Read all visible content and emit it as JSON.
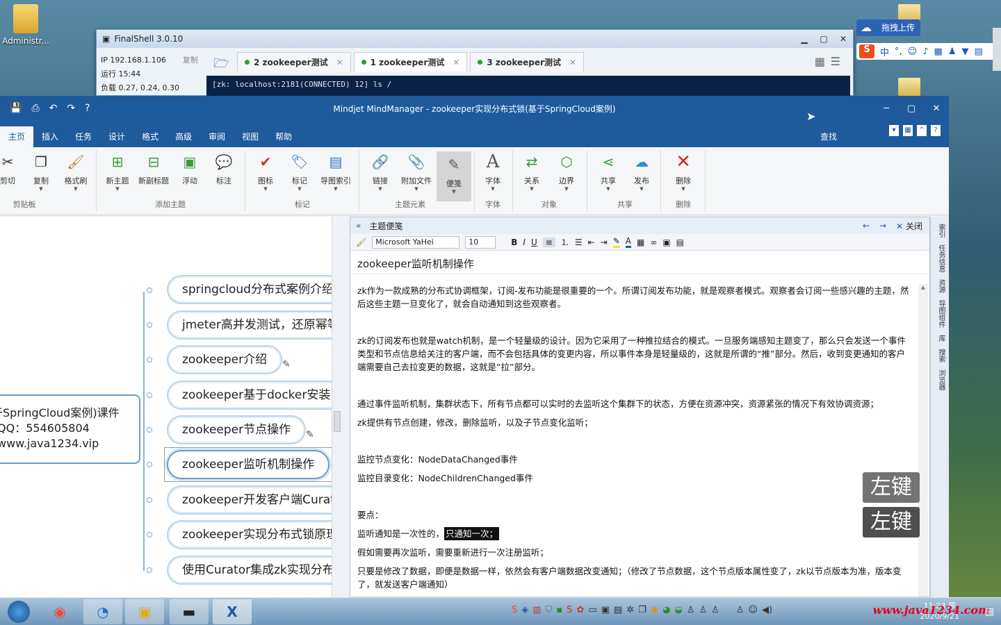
{
  "desktop": {
    "admin_label": "Administr..."
  },
  "finalshell": {
    "title": "FinalShell 3.0.10",
    "ip": "IP 192.168.1.106",
    "copy": "复制",
    "uptime": "运行 15:44",
    "load": "负载 0.27, 0.24, 0.30",
    "tabs": [
      {
        "label": "2 zookeeper测试"
      },
      {
        "label": "1 zookeeper测试"
      },
      {
        "label": "3 zookeeper测试"
      }
    ],
    "terminal": "[zk: localhost:2181(CONNECTED) 12] ls /"
  },
  "sogou": {
    "upload": "拖拽上传",
    "zh": "中"
  },
  "mindmanager": {
    "title": "Mindjet MindManager - zookeeper实现分布式锁(基于SpringCloud案例)",
    "menu": [
      "主页",
      "插入",
      "任务",
      "设计",
      "格式",
      "高级",
      "审阅",
      "视图",
      "帮助"
    ],
    "find": "查找",
    "ribbon": {
      "cut": "剪切",
      "copy": "复制",
      "format_painter": "格式刷",
      "new_topic": "新主题",
      "new_subtopic": "新副标题",
      "floating": "浮动",
      "callout": "标注",
      "icons": "图标",
      "tags": "标记",
      "map_index": "导图索引",
      "link": "链接",
      "attachment": "附加文件",
      "note": "便笺",
      "font": "字体",
      "relationship": "关系",
      "boundary": "边界",
      "share": "共享",
      "publish": "发布",
      "delete": "删除",
      "groups": {
        "clipboard": "剪贴板",
        "add_topic": "添加主题",
        "tags": "标记",
        "topic_elements": "主题元素",
        "font": "字体",
        "objects": "对象",
        "share": "共享",
        "delete": "删除"
      }
    },
    "map": {
      "central": [
        "于SpringCloud案例)课件",
        "QQ：554605804",
        "www.java1234.vip"
      ],
      "nodes": [
        "springcloud分布式案例介绍",
        "jmeter高并发测试，还原幂等",
        "zookeeper介绍",
        "zookeeper基于docker安装",
        "zookeeper节点操作",
        "zookeeper监听机制操作",
        "zookeeper开发客户端Curator",
        "zookeeper实现分布式锁原理",
        "使用Curator集成zk实现分布式"
      ]
    },
    "note": {
      "panel_title": "主题便笺",
      "close": "关闭",
      "font": "Microsoft YaHei",
      "size": "10",
      "topic_title": "zookeeper监听机制操作",
      "paragraphs": [
        "zk作为一款成熟的分布式协调框架，订阅-发布功能是很重要的一个。所谓订阅发布功能，就是观察者模式。观察者会订阅一些感兴趣的主题，然后这些主题一旦变化了，就会自动通知到这些观察者。",
        "zk的订阅发布也就是watch机制，是一个轻量级的设计。因为它采用了一种推拉结合的模式。一旦服务端感知主题变了，那么只会发送一个事件类型和节点信息给关注的客户端，而不会包括具体的变更内容，所以事件本身是轻量级的，这就是所谓的“推”部分。然后，收到变更通知的客户端需要自己去拉变更的数据，这就是“拉”部分。",
        "通过事件监听机制，集群状态下，所有节点都可以实时的去监听这个集群下的状态，方便在资源冲突，资源紧张的情况下有效协调资源；",
        "zk提供有节点创建，修改，删除监听，以及子节点变化监听；",
        "监控节点变化：NodeDataChanged事件",
        "监控目录变化：NodeChildrenChanged事件",
        "要点：",
        "监听通知是一次性的，",
        "只通知一次；",
        "假如需要再次监听，需要重新进行一次注册监听；",
        "只要是修改了数据，即便是数据一样，依然会有客户端数据改变通知；（修改了节点数据，这个节点版本属性变了，zk以节点版本为准，版本变了，就发送客户端通知）"
      ]
    },
    "side": [
      "索引",
      "任务信息",
      "资源",
      "导图组件",
      "库",
      "搜索",
      "浏览器"
    ]
  },
  "overlay": {
    "left_key": "左键"
  },
  "taskbar": {
    "time": "11:23 周",
    "date": "2020/9/21",
    "watermark": "www.java1234.com"
  }
}
